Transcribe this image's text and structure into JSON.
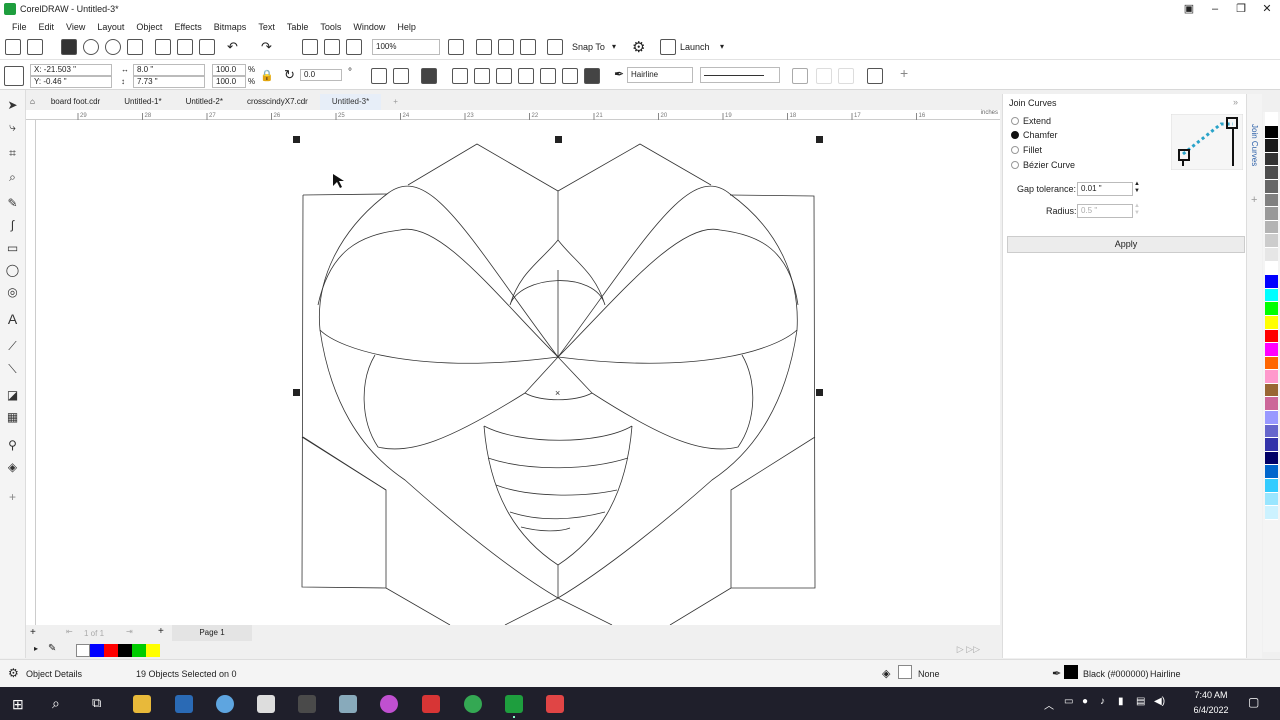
{
  "app": {
    "title": "CorelDRAW - Untitled-3*"
  },
  "menu": [
    "File",
    "Edit",
    "View",
    "Layout",
    "Object",
    "Effects",
    "Bitmaps",
    "Text",
    "Table",
    "Tools",
    "Window",
    "Help"
  ],
  "toolbar": {
    "zoom": "100%",
    "snap_to": "Snap To",
    "launch": "Launch"
  },
  "propbar": {
    "x": "X: -21.503 \"",
    "y": "Y: -0.46 \"",
    "w": "8.0 \"",
    "h": "7.73 \"",
    "sx": "100.0",
    "sy": "100.0",
    "pct": "%",
    "angle": "0.0",
    "deg": "°",
    "outline": "Hairline"
  },
  "tabs": [
    "board foot.cdr",
    "Untitled-1*",
    "Untitled-2*",
    "crosscindyX7.cdr",
    "Untitled-3*"
  ],
  "active_tab": 4,
  "ruler": {
    "h_ticks": [
      "29",
      "28",
      "27",
      "26",
      "25",
      "24",
      "23",
      "22",
      "21",
      "20",
      "19",
      "18",
      "17",
      "16"
    ],
    "unit": "inches"
  },
  "page_nav": {
    "of": "1  of  1",
    "page": "Page 1"
  },
  "docker": {
    "title": "Join Curves",
    "side_tab_label": "Join Curves",
    "options": [
      "Extend",
      "Chamfer",
      "Fillet",
      "Bézier Curve"
    ],
    "selected": "Chamfer",
    "gap_label": "Gap tolerance:",
    "gap_value": "0.01 \"",
    "radius_label": "Radius:",
    "radius_value": "0.5 \"",
    "apply": "Apply"
  },
  "status": {
    "object_details": "Object Details",
    "selection": "19 Objects Selected on 0",
    "fill": "None",
    "outline": "Black (#000000)",
    "outline_width": "Hairline"
  },
  "clock": {
    "time": "7:40 AM",
    "date": "6/4/2022"
  },
  "document_palette": [
    "#0000ff",
    "#ff0000",
    "#000000",
    "#00cc00",
    "#ffff00"
  ],
  "color_palette": [
    "#ffffff",
    "#000000",
    "#1a1a1a",
    "#333333",
    "#4d4d4d",
    "#666666",
    "#808080",
    "#999999",
    "#b3b3b3",
    "#cccccc",
    "#e6e6e6",
    "#ffffff",
    "#0000ff",
    "#00ffff",
    "#00ff00",
    "#ffff00",
    "#ff0000",
    "#ff00ff",
    "#ff6600",
    "#ff99cc",
    "#996633",
    "#cc6699",
    "#9999ff",
    "#6666cc",
    "#3333aa",
    "#000066",
    "#0066cc",
    "#33ccff",
    "#99e6ff",
    "#ccf2ff"
  ]
}
